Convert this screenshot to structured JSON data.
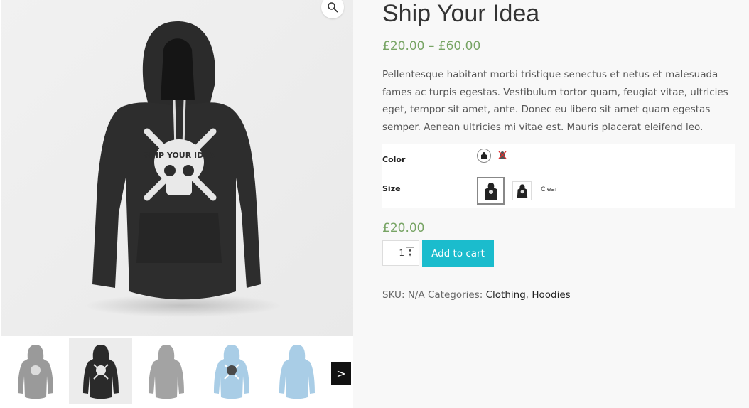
{
  "product": {
    "title": "Ship Your Idea",
    "price_range": "£20.00 – £60.00",
    "description": "Pellentesque habitant morbi tristique senectus et netus et malesuada fames ac turpis egestas. Vestibulum tortor quam, feugiat vitae, ultricies eget, tempor sit amet, ante. Donec eu libero sit amet quam egestas semper. Aenean ultricies mi vitae est. Mauris placerat eleifend leo.",
    "selected_price": "£20.00",
    "main_image_text": "SHIP YOUR IDEA",
    "colors": {
      "primary": "#77a464",
      "button": "#1bbccd",
      "hoodie_dark": "#2a2a2a",
      "hoodie_blue": "#a9cde6",
      "hoodie_grey": "#9a9a9a"
    }
  },
  "variations": {
    "color_label": "Color",
    "size_label": "Size",
    "clear_label": "Clear"
  },
  "cart": {
    "quantity": "1",
    "add_to_cart_label": "Add to cart"
  },
  "meta": {
    "sku_label": "SKU:",
    "sku_value": "N/A",
    "categories_label": "Categories:",
    "category_1": "Clothing",
    "separator": ",",
    "category_2": "Hoodies"
  },
  "gallery": {
    "next_label": ">",
    "thumbnails": [
      {
        "color": "grey-print"
      },
      {
        "color": "black-print"
      },
      {
        "color": "grey"
      },
      {
        "color": "blue-print"
      },
      {
        "color": "blue"
      }
    ]
  },
  "icons": {
    "zoom": "magnifier-icon",
    "next": "chevron-right-icon"
  }
}
